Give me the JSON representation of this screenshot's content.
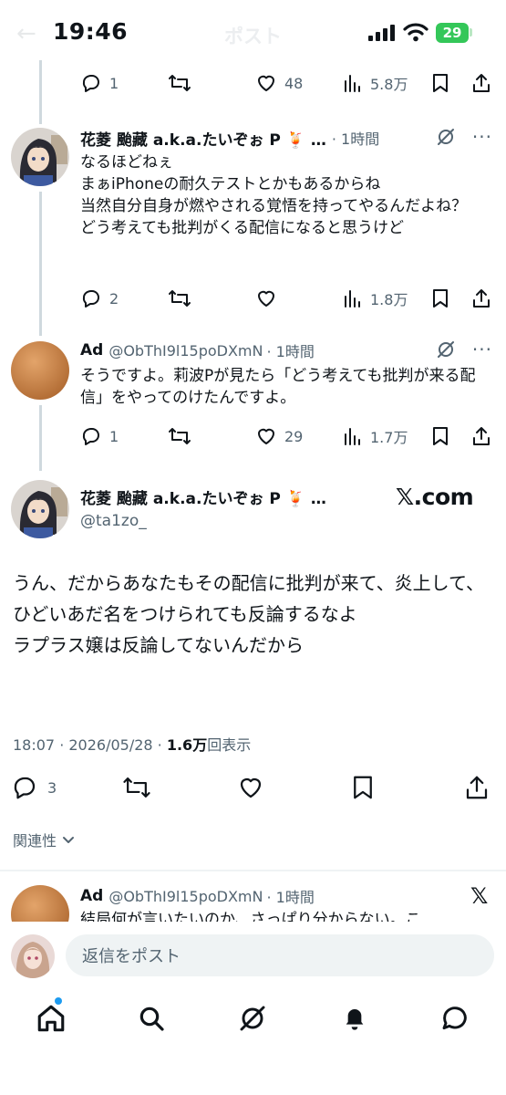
{
  "status_bar": {
    "time": "19:46",
    "battery": "29"
  },
  "ghost_header": {
    "back": "←",
    "title": "ポスト"
  },
  "top_actions": {
    "replies": "1",
    "reposts": "",
    "likes": "48",
    "views": "5.8万"
  },
  "replies": [
    {
      "name": "花菱 颱藏 a.k.a.たいぞぉ P 🍹 …",
      "time": "· 1時間",
      "text": "なるほどねぇ\nまぁiPhoneの耐久テストとかもあるからね\n当然自分自身が燃やされる覚悟を持ってやるんだよね？\nどう考えても批判がくる配信になると思うけど",
      "replies": "2",
      "reposts": "",
      "likes": "",
      "views": "1.8万"
    },
    {
      "name": "Ad",
      "handle": "@ObThI9l15poDXmN",
      "time": "· 1時間",
      "text": "そうですよ。莉波Pが見たら「どう考えても批判が来る配信」をやってのけたんですよ。",
      "replies": "1",
      "reposts": "",
      "likes": "29",
      "views": "1.7万"
    }
  ],
  "main_tweet": {
    "name": "花菱 颱藏 a.k.a.たいぞぉ P 🍹 …",
    "handle": "@ta1zo_",
    "watermark": "𝕏.com",
    "text": "うん、だからあなたもその配信に批判が来て、炎上して、ひどいあだ名をつけられても反論するなよ\nラプラス嬢は反論してないんだから",
    "datetime": "18:07 · 2026/05/28 · ",
    "views_count": "1.6万",
    "views_label": "回表示",
    "replies": "3",
    "reposts": "",
    "likes": "",
    "sort_label": "関連性"
  },
  "next_reply": {
    "name": "Ad",
    "handle": "@ObThI9l15poDXmN",
    "time": "· 1時間",
    "text_partial": "結局何が言いたいのか、さっぱり分からない。こ",
    "badge": "𝕏"
  },
  "composer": {
    "placeholder": "返信をポスト"
  },
  "colors": {
    "accent": "#1d9bf0",
    "muted": "#536471",
    "battery": "#34c759",
    "line": "#cfd9de"
  },
  "icons": [
    "reply-icon",
    "repost-icon",
    "like-icon",
    "views-icon",
    "bookmark-icon",
    "share-icon",
    "grok-icon",
    "more-icon",
    "home-icon",
    "search-icon",
    "grok-tab-icon",
    "notifications-icon",
    "messages-icon"
  ]
}
